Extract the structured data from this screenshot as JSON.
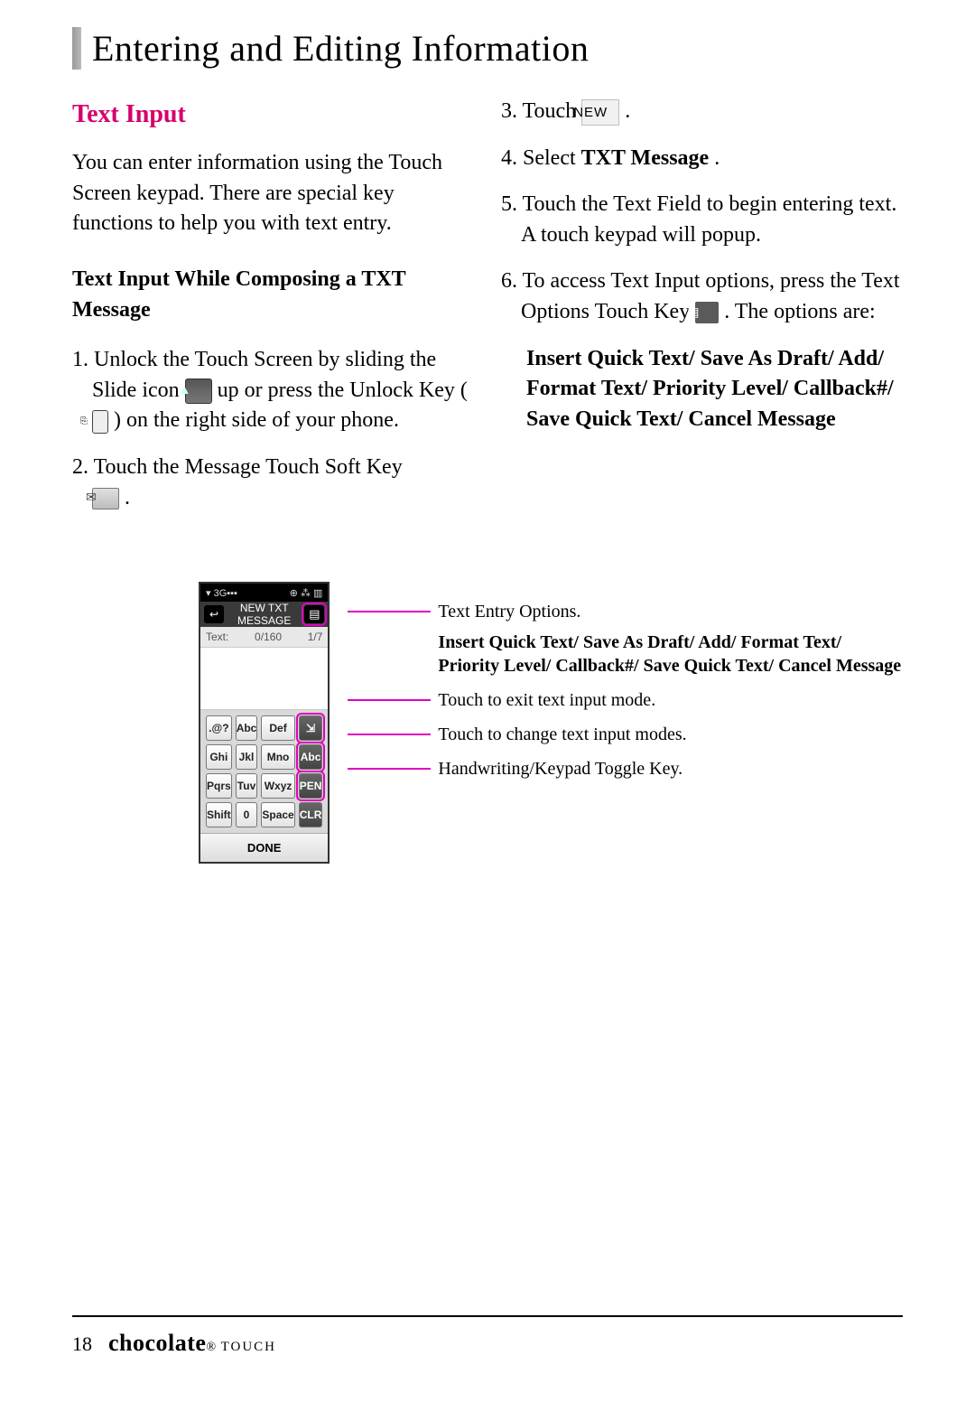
{
  "page": {
    "title": "Entering and Editing Information",
    "number": "18",
    "brand": "chocolate",
    "brand_suffix": "TOUCH"
  },
  "section": {
    "heading": "Text Input",
    "intro": "You can enter information using the Touch Screen keypad. There are special key functions to help you with text entry.",
    "sub_heading": "Text Input While Composing a TXT Message"
  },
  "steps": {
    "s1_a": "1. Unlock the Touch Screen by sliding the Slide icon ",
    "s1_b": " up or press the Unlock Key ( ",
    "s1_c": " ) on the right side of your phone.",
    "s2_a": "2. Touch the Message Touch Soft Key ",
    "s2_b": ".",
    "s3_a": "3. Touch ",
    "s3_new": "NEW",
    "s3_b": " .",
    "s4_a": "4. Select ",
    "s4_bold": "TXT Message",
    "s4_b": ".",
    "s5": "5. Touch the Text Field to begin entering text. A touch keypad will popup.",
    "s6_a": "6. To access Text Input options, press the Text Options Touch Key ",
    "s6_b": ". The options are:",
    "options": "Insert Quick Text/ Save As Draft/ Add/ Format Text/ Priority Level/ Callback#/ Save Quick Text/ Cancel Message"
  },
  "phone": {
    "status_left": "▾ 3G▪▪▪",
    "status_right": "⊕  ⁂  ▥",
    "title": "NEW TXT MESSAGE",
    "info_left": "Text:",
    "info_mid": "0/160",
    "info_right": "1/7",
    "done": "DONE",
    "keys": [
      ".@?",
      "Abc",
      "Def",
      "⇲",
      "Ghi",
      "Jkl",
      "Mno",
      "Abc",
      "Pqrs",
      "Tuv",
      "Wxyz",
      "PEN",
      "Shift",
      "0",
      "Space",
      "CLR"
    ]
  },
  "callouts": {
    "c1": "Text Entry Options.",
    "c2": "Insert Quick Text/ Save As Draft/ Add/ Format Text/ Priority Level/ Callback#/ Save Quick Text/ Cancel Message",
    "c3": "Touch to exit text input mode.",
    "c4": "Touch to change text input modes.",
    "c5": "Handwriting/Keypad Toggle Key."
  }
}
